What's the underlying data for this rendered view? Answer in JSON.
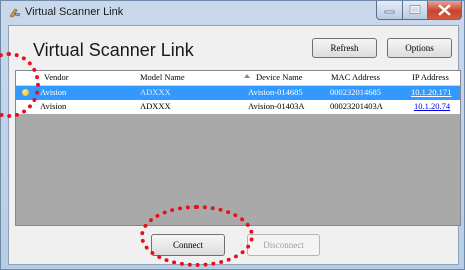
{
  "window": {
    "title": "Virtual Scanner Link"
  },
  "toolbar": {
    "heading": "Virtual Scanner Link",
    "refresh_label": "Refresh",
    "options_label": "Options"
  },
  "table": {
    "columns": [
      "Vendor",
      "Model Name",
      "Device Name",
      "MAC Address",
      "IP Address"
    ],
    "rows": [
      {
        "vendor": "Avision",
        "model": "ADXXX",
        "device": "Avision-014685",
        "mac": "000232014685",
        "ip": "10.1.20.171",
        "selected": true
      },
      {
        "vendor": "Avision",
        "model": "ADXXX",
        "device": "Avision-01403A",
        "mac": "00023201403A",
        "ip": "10.1.20.74",
        "selected": false
      }
    ]
  },
  "footer": {
    "connect_label": "Connect",
    "disconnect_label": "Disconnect"
  },
  "colors": {
    "selection": "#3399ff",
    "annotation_ring": "#e8101c",
    "close_button": "#c6452c"
  },
  "icons": [
    "scanner-app-icon",
    "minimize-icon",
    "maximize-icon",
    "close-icon",
    "sort-ascending-icon",
    "device-status-icon"
  ]
}
